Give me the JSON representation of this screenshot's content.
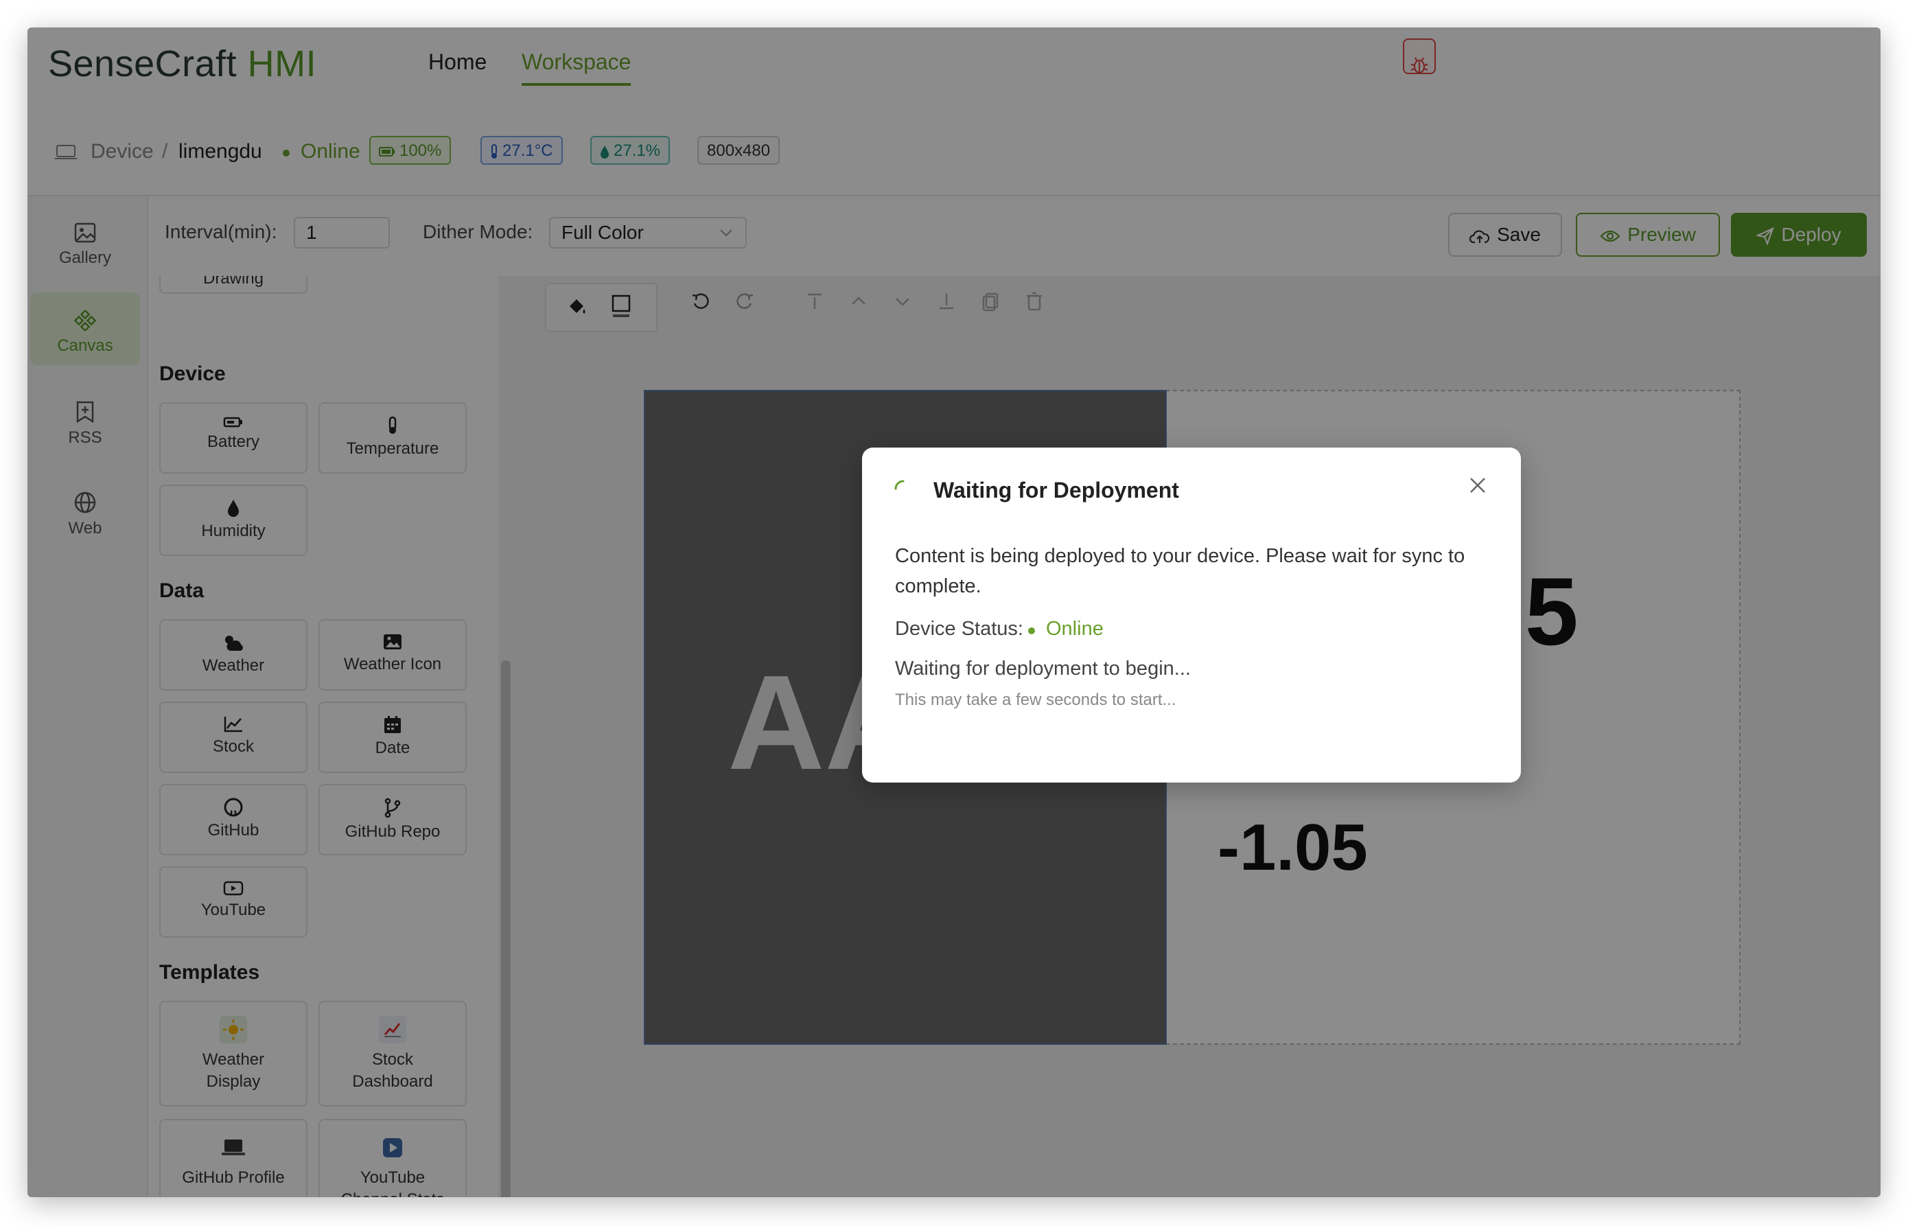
{
  "app": {
    "logo_main": "SenseCraft",
    "logo_accent": "HMI"
  },
  "nav": {
    "home": "Home",
    "workspace": "Workspace"
  },
  "device": {
    "crumb_root": "Device",
    "separator": "/",
    "name": "limengdu",
    "status": "Online",
    "battery": "100%",
    "temperature": "27.1°C",
    "humidity": "27.1%",
    "resolution": "800x480"
  },
  "sidebar": {
    "items": [
      {
        "label": "Gallery",
        "icon": "image-icon"
      },
      {
        "label": "Canvas",
        "icon": "canvas-icon"
      },
      {
        "label": "RSS",
        "icon": "bookmark-plus-icon"
      },
      {
        "label": "Web",
        "icon": "globe-icon"
      }
    ]
  },
  "toolbar": {
    "interval_label": "Interval(min):",
    "interval_value": "1",
    "dither_label": "Dither Mode:",
    "dither_value": "Full Color",
    "save": "Save",
    "preview": "Preview",
    "deploy": "Deploy"
  },
  "components": {
    "drawing": "Drawing",
    "device_title": "Device",
    "device": [
      "Battery",
      "Temperature",
      "Humidity"
    ],
    "data_title": "Data",
    "data": [
      "Weather",
      "Weather Icon",
      "Stock",
      "Date",
      "GitHub",
      "GitHub Repo",
      "YouTube"
    ],
    "templates_title": "Templates",
    "templates": [
      {
        "line1": "Weather",
        "line2": "Display"
      },
      {
        "line1": "Stock",
        "line2": "Dashboard"
      },
      {
        "line1": "GitHub Profile",
        "line2": ""
      },
      {
        "line1": "YouTube",
        "line2": "Channel Stats"
      }
    ]
  },
  "canvas": {
    "big_text": "AA",
    "value_top": "05",
    "value_bottom": "-1.05"
  },
  "modal": {
    "title": "Waiting for Deployment",
    "message": "Content is being deployed to your device. Please wait for sync to complete.",
    "status_label": "Device Status:",
    "status_value": "Online",
    "waiting": "Waiting for deployment to begin...",
    "note": "This may take a few seconds to start..."
  },
  "colors": {
    "brand_green": "#5a9a2a",
    "danger": "#e04848",
    "overlay": "rgba(0,0,0,0.45)"
  }
}
